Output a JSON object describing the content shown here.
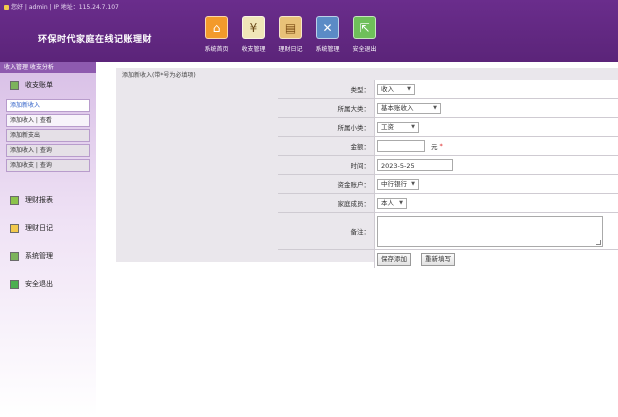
{
  "header": {
    "user_info": "您好 | admin  | IP 地址：115.24.7.107",
    "app_title": "环保时代家庭在线记账理财",
    "nav": [
      {
        "label": "系统首页",
        "icon": "house-icon"
      },
      {
        "label": "收支管理",
        "icon": "yen-icon"
      },
      {
        "label": "理财日记",
        "icon": "book-icon"
      },
      {
        "label": "系统管理",
        "icon": "tools-icon"
      },
      {
        "label": "安全退出",
        "icon": "exit-icon"
      }
    ]
  },
  "sidebar": {
    "header": "收入管理  收支分析",
    "groups_top": [
      {
        "label": "收支账单"
      }
    ],
    "subitems": [
      {
        "label": "添加新收入",
        "state": "active"
      },
      {
        "label": "添加收入 | 查看",
        "state": "normal"
      },
      {
        "label": "添加新支出",
        "state": "dark"
      },
      {
        "label": "添加收入 | 查询",
        "state": "dark"
      },
      {
        "label": "添加收支 | 查询",
        "state": "dark"
      }
    ],
    "groups_bottom": [
      {
        "label": "理财报表"
      },
      {
        "label": "理财日记"
      },
      {
        "label": "系统管理"
      },
      {
        "label": "安全退出"
      }
    ]
  },
  "content": {
    "title": "添加新收入(带*号为必填项)",
    "form": {
      "type_label": "类型：",
      "type_value": "收入",
      "category_label": "所属大类：",
      "category_value": "基本账收入",
      "subcategory_label": "所属小类：",
      "subcategory_value": "工资",
      "amount_label": "金额：",
      "amount_value": "",
      "amount_unit": "元",
      "amount_required": "*",
      "date_label": "时间：",
      "date_value": "2023-5-25",
      "account_label": "资金账户：",
      "account_value": "中行银行",
      "member_label": "家庭成员：",
      "member_value": "本人",
      "memo_label": "备注：",
      "memo_value": "",
      "submit_label": "保存添加",
      "reset_label": "重新填写"
    }
  },
  "colors": {
    "header_bg": "#5b2479",
    "sidebar_head": "#8e5aaf",
    "content_bg": "#eae7ec",
    "required": "#dd2222"
  }
}
